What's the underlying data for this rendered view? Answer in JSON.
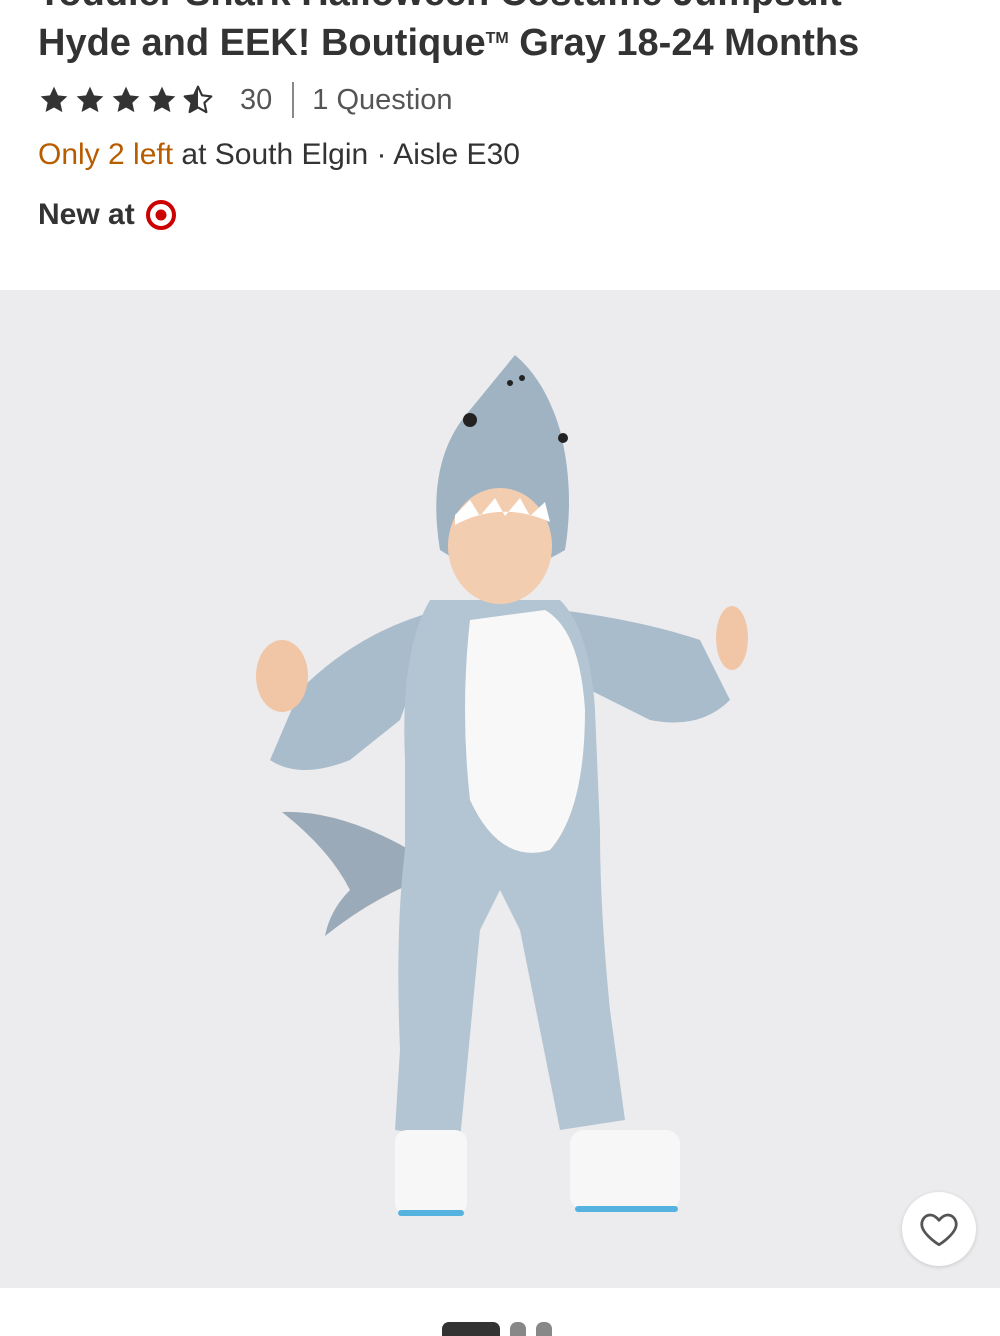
{
  "product": {
    "title_line1": "Toddler Shark Halloween Costume Jumpsuit -",
    "title_line2": "Hyde and EEK! Boutique",
    "title_tm": "TM",
    "title_line2_end": " Gray 18-24 Months"
  },
  "rating": {
    "stars": 4.5,
    "count": "30",
    "questions": "1 Question"
  },
  "stock": {
    "availability": "Only 2 left",
    "store": " at South Elgin · Aisle E30"
  },
  "badge": {
    "new_label": "New at"
  },
  "gallery": {
    "total_dots": 3,
    "active_index": 0
  },
  "colors": {
    "accent": "#cc0000",
    "stock_orange": "#b85c00",
    "text": "#333333",
    "image_bg": "#ececee"
  },
  "icons": {
    "favorite": "heart-outline-icon",
    "brand": "target-bullseye-icon",
    "rating": "star-icon"
  }
}
